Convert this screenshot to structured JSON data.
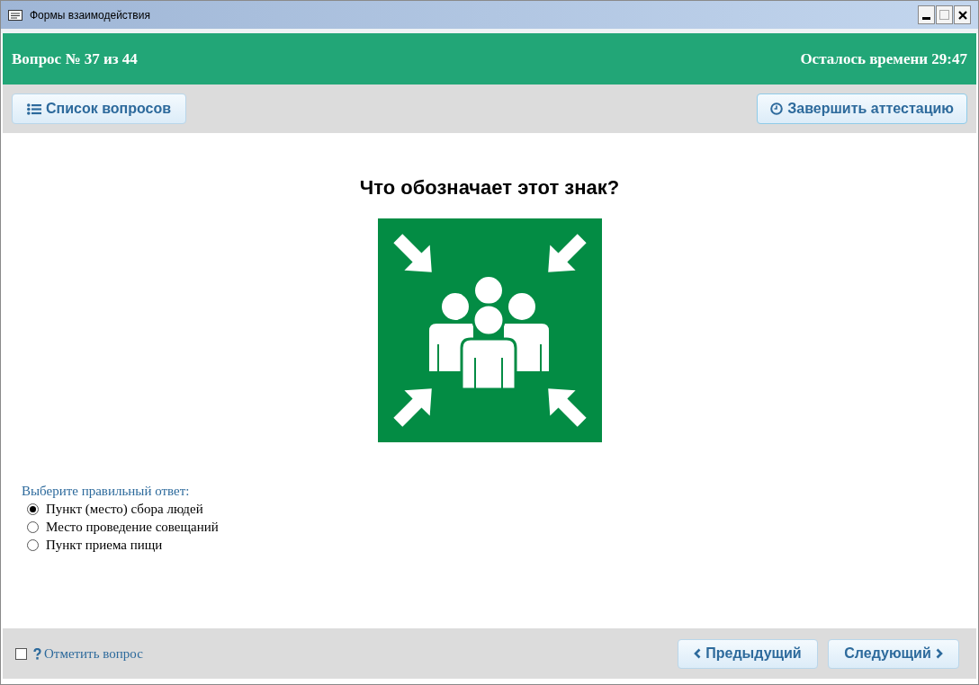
{
  "window": {
    "title": "Формы взаимодействия"
  },
  "header": {
    "question_counter": "Вопрос № 37 из 44",
    "time_left": "Осталось времени 29:47"
  },
  "toolbar": {
    "list_button": "Список вопросов",
    "finish_button": "Завершить аттестацию"
  },
  "question": {
    "text": "Что обозначает этот знак?",
    "prompt": "Выберите правильный ответ:",
    "answers": [
      {
        "label": "Пункт (место) сбора людей",
        "selected": true
      },
      {
        "label": "Место проведение совещаний",
        "selected": false
      },
      {
        "label": "Пункт приема пищи",
        "selected": false
      }
    ]
  },
  "footer": {
    "mark_label": "Отметить вопрос",
    "mark_checked": false,
    "prev_button": "Предыдущий",
    "next_button": "Следующий"
  }
}
